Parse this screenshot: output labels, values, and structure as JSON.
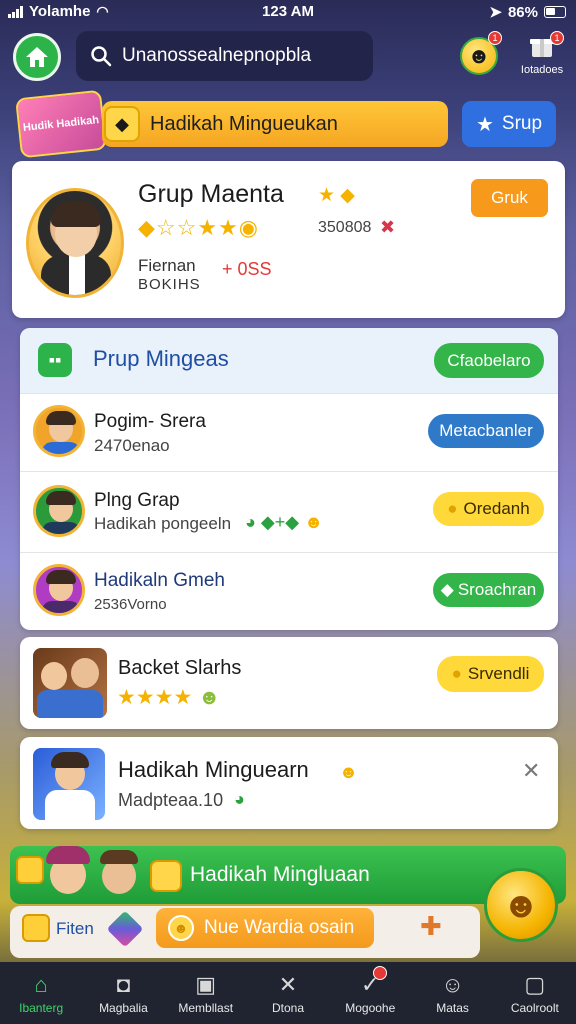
{
  "status": {
    "carrier": "Yolamhe",
    "time": "123 AM",
    "battery": "86%"
  },
  "header": {
    "search_text": "Unanossealnepnopbla",
    "profile_label": "Iotadoes",
    "search_badge": "1",
    "profile_badge": "1"
  },
  "promo": {
    "art_text": "Hudik Hadikah",
    "title": "Hadikah Mingueukan",
    "grup_button": "Srup"
  },
  "profile": {
    "name": "Grup Maenta",
    "count": "350808",
    "sub1": "Fiernan",
    "sub2": "BOKIHS",
    "stat": "+ 0SS",
    "button": "Gruk"
  },
  "list": {
    "title": "Prup Mingeas",
    "head_button": "Cfaobelaro",
    "rows": [
      {
        "title": "Pogim- Srera",
        "sub": "2470enao",
        "button": "Metacbanler",
        "button_style": "blue",
        "avatar_color": "#f0a42a"
      },
      {
        "title": "Plng Grap",
        "sub": "Hadikah pongeeln",
        "button": "Oredanh",
        "button_style": "yellow",
        "avatar_color": "#2a9a3a"
      },
      {
        "title": "Hadikaln Gmeh",
        "sub": "2536Vorno",
        "button": "Sroachran",
        "button_style": "green",
        "avatar_color": "#b03cc4"
      }
    ]
  },
  "card2": {
    "title": "Backet Slarhs",
    "button": "Srvendli"
  },
  "card3": {
    "title": "Hadikah Minguearn",
    "sub": "Madpteaa.10"
  },
  "green_banner": {
    "title": "Hadikah Mingluaan"
  },
  "action_bar": {
    "label": "Fiten",
    "orange_button": "Nue Wardia osain"
  },
  "tabs": [
    {
      "label": "Ibanterg",
      "icon": "⌂",
      "active": true
    },
    {
      "label": "Magbalia",
      "icon": "◘",
      "active": false
    },
    {
      "label": "Membllast",
      "icon": "▣",
      "active": false
    },
    {
      "label": "Dtona",
      "icon": "✕",
      "active": false
    },
    {
      "label": "Mogoohe",
      "icon": "✓",
      "active": false
    },
    {
      "label": "Matas",
      "icon": "☺",
      "active": false
    },
    {
      "label": "Caolroolt",
      "icon": "▢",
      "active": false
    }
  ],
  "colors": {
    "accent_green": "#34b54a",
    "accent_blue": "#2f79c9",
    "accent_orange": "#f79a1b",
    "accent_yellow": "#ffd83a"
  }
}
